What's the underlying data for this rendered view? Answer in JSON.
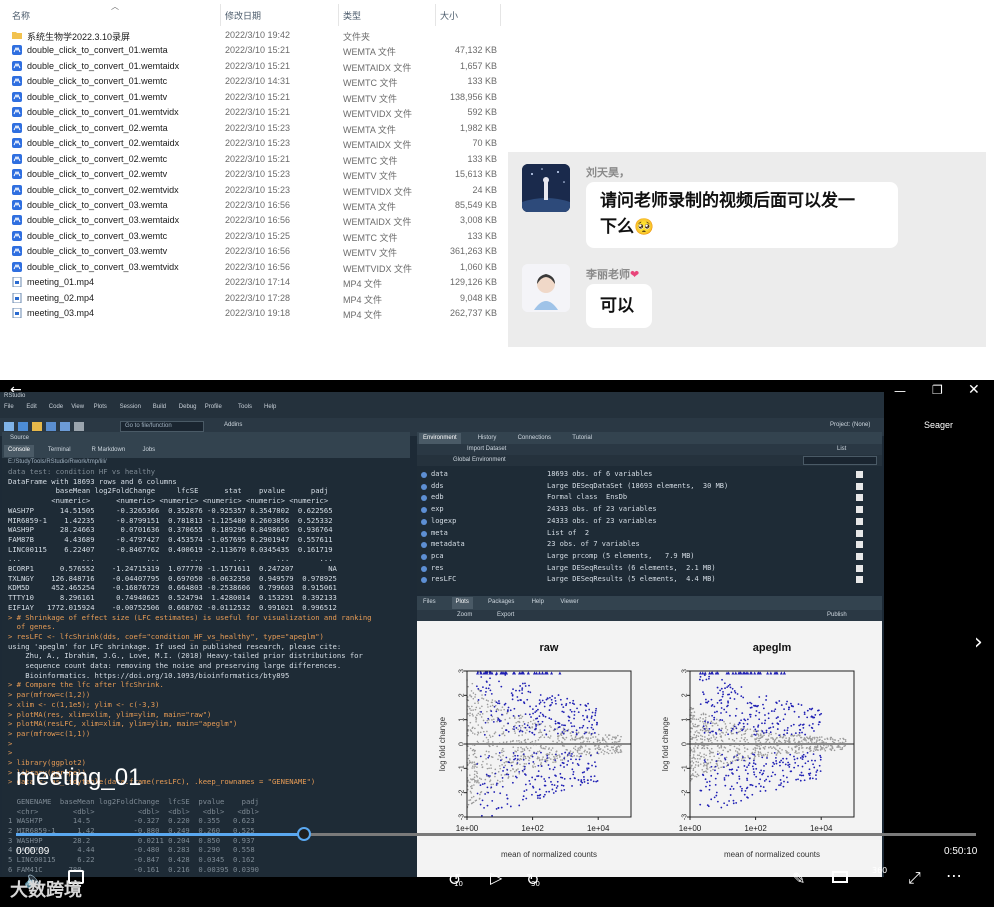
{
  "explorer": {
    "columns": {
      "name": "名称",
      "date": "修改日期",
      "type": "类型",
      "size": "大小"
    },
    "files": [
      {
        "name": "系统生物学2022.3.10录屏",
        "date": "2022/3/10 19:42",
        "type": "文件夹",
        "size": "",
        "icon": "folder-icon"
      },
      {
        "name": "double_click_to_convert_01.wemta",
        "date": "2022/3/10 15:21",
        "type": "WEMTA 文件",
        "size": "47,132 KB",
        "icon": "wemeet-file-icon"
      },
      {
        "name": "double_click_to_convert_01.wemtaidx",
        "date": "2022/3/10 15:21",
        "type": "WEMTAIDX 文件",
        "size": "1,657 KB",
        "icon": "wemeet-file-icon"
      },
      {
        "name": "double_click_to_convert_01.wemtc",
        "date": "2022/3/10 14:31",
        "type": "WEMTC 文件",
        "size": "133 KB",
        "icon": "wemeet-file-icon"
      },
      {
        "name": "double_click_to_convert_01.wemtv",
        "date": "2022/3/10 15:21",
        "type": "WEMTV 文件",
        "size": "138,956 KB",
        "icon": "wemeet-file-icon"
      },
      {
        "name": "double_click_to_convert_01.wemtvidx",
        "date": "2022/3/10 15:21",
        "type": "WEMTVIDX 文件",
        "size": "592 KB",
        "icon": "wemeet-file-icon"
      },
      {
        "name": "double_click_to_convert_02.wemta",
        "date": "2022/3/10 15:23",
        "type": "WEMTA 文件",
        "size": "1,982 KB",
        "icon": "wemeet-file-icon"
      },
      {
        "name": "double_click_to_convert_02.wemtaidx",
        "date": "2022/3/10 15:23",
        "type": "WEMTAIDX 文件",
        "size": "70 KB",
        "icon": "wemeet-file-icon"
      },
      {
        "name": "double_click_to_convert_02.wemtc",
        "date": "2022/3/10 15:21",
        "type": "WEMTC 文件",
        "size": "133 KB",
        "icon": "wemeet-file-icon"
      },
      {
        "name": "double_click_to_convert_02.wemtv",
        "date": "2022/3/10 15:23",
        "type": "WEMTV 文件",
        "size": "15,613 KB",
        "icon": "wemeet-file-icon"
      },
      {
        "name": "double_click_to_convert_02.wemtvidx",
        "date": "2022/3/10 15:23",
        "type": "WEMTVIDX 文件",
        "size": "24 KB",
        "icon": "wemeet-file-icon"
      },
      {
        "name": "double_click_to_convert_03.wemta",
        "date": "2022/3/10 16:56",
        "type": "WEMTA 文件",
        "size": "85,549 KB",
        "icon": "wemeet-file-icon"
      },
      {
        "name": "double_click_to_convert_03.wemtaidx",
        "date": "2022/3/10 16:56",
        "type": "WEMTAIDX 文件",
        "size": "3,008 KB",
        "icon": "wemeet-file-icon"
      },
      {
        "name": "double_click_to_convert_03.wemtc",
        "date": "2022/3/10 15:25",
        "type": "WEMTC 文件",
        "size": "133 KB",
        "icon": "wemeet-file-icon"
      },
      {
        "name": "double_click_to_convert_03.wemtv",
        "date": "2022/3/10 16:56",
        "type": "WEMTV 文件",
        "size": "361,263 KB",
        "icon": "wemeet-file-icon"
      },
      {
        "name": "double_click_to_convert_03.wemtvidx",
        "date": "2022/3/10 16:56",
        "type": "WEMTVIDX 文件",
        "size": "1,060 KB",
        "icon": "wemeet-file-icon"
      },
      {
        "name": "meeting_01.mp4",
        "date": "2022/3/10 17:14",
        "type": "MP4 文件",
        "size": "129,126 KB",
        "icon": "mp4-file-icon"
      },
      {
        "name": "meeting_02.mp4",
        "date": "2022/3/10 17:28",
        "type": "MP4 文件",
        "size": "9,048 KB",
        "icon": "mp4-file-icon"
      },
      {
        "name": "meeting_03.mp4",
        "date": "2022/3/10 19:18",
        "type": "MP4 文件",
        "size": "262,737 KB",
        "icon": "mp4-file-icon"
      }
    ]
  },
  "chat": {
    "msg1": {
      "sender": "刘天昊，",
      "text_line1": "请问老师录制的视频后面可以发一",
      "text_line2": "下么",
      "emoji": "🥺"
    },
    "msg2": {
      "sender": "李丽老师",
      "heart": "❤",
      "text": "可以"
    }
  },
  "player": {
    "caption": "meeting_01",
    "viewer_name": "Seager",
    "time_current": "0:00:09",
    "time_total": "0:50:10",
    "progress": 0.3,
    "skip_back": "10",
    "skip_forward": "30",
    "quality": "360",
    "watermark": "大数跨境",
    "accent": "#5aa8f0"
  },
  "rstudio": {
    "title": "RStudio",
    "menu": [
      "File",
      "Edit",
      "Code",
      "View",
      "Plots",
      "Session",
      "Build",
      "Debug",
      "Profile",
      "Tools",
      "Help"
    ],
    "go_to": "Go to file/function",
    "addins": "Addins",
    "project": "Project: (None)",
    "source_tab": "Source",
    "console_tabs": [
      "Console",
      "Terminal",
      "R Markdown",
      "Jobs"
    ],
    "console_path": "E:/StudyTools/RStudio/Rwork/tmp/lili/",
    "console_lines": [
      {
        "t": "data test: condition HF vs healthy",
        "c": "fade"
      },
      {
        "t": "DataFrame with 18693 rows and 6 columns",
        "c": ""
      },
      {
        "t": "           baseMean log2FoldChange     lfcSE      stat    pvalue      padj",
        "c": ""
      },
      {
        "t": "          <numeric>      <numeric> <numeric> <numeric> <numeric> <numeric>",
        "c": ""
      },
      {
        "t": "WASH7P      14.51505     -0.3265366  0.352876 -0.925357 0.3547802  0.622565",
        "c": ""
      },
      {
        "t": "MIR6859-1    1.42235     -0.8799151  0.781813 -1.125480 0.2603856  0.525332",
        "c": ""
      },
      {
        "t": "WASH9P      28.24663      0.0701636  0.370655  0.189296 0.8498605  0.936764",
        "c": ""
      },
      {
        "t": "FAM87B       4.43689     -0.4797427  0.453574 -1.057695 0.2901947  0.557611",
        "c": ""
      },
      {
        "t": "LINC00115    6.22407     -0.8467762  0.400619 -2.113670 0.0345435  0.161719",
        "c": ""
      },
      {
        "t": "...              ...            ...       ...       ...       ...       ...",
        "c": ""
      },
      {
        "t": "BCORP1      0.576552    -1.24715319  1.077770 -1.1571611  0.247207        NA",
        "c": ""
      },
      {
        "t": "TXLNGY    126.848716    -0.04407795  0.697050 -0.0632350  0.949579  0.978925",
        "c": ""
      },
      {
        "t": "KDM5D     452.465254    -0.16876729  0.664803 -0.2538606  0.799603  0.915061",
        "c": ""
      },
      {
        "t": "TTTY10      8.296161     0.74940625  0.524794  1.4280014  0.153291  0.392133",
        "c": ""
      },
      {
        "t": "EIF1AY   1772.015924    -0.00752506  0.668702 -0.0112532  0.991021  0.996512",
        "c": ""
      },
      {
        "t": "> # Shrinkage of effect size (LFC estimates) is useful for visualization and ranking",
        "c": "cmd"
      },
      {
        "t": "  of genes.",
        "c": "cmd"
      },
      {
        "t": "> resLFC <- lfcShrink(dds, coef=\"condition_HF_vs_healthy\", type=\"apeglm\")",
        "c": "cmd"
      },
      {
        "t": "using 'apeglm' for LFC shrinkage. If used in published research, please cite:",
        "c": ""
      },
      {
        "t": "    Zhu, A., Ibrahim, J.G., Love, M.I. (2018) Heavy-tailed prior distributions for",
        "c": ""
      },
      {
        "t": "    sequence count data: removing the noise and preserving large differences.",
        "c": ""
      },
      {
        "t": "    Bioinformatics. https://doi.org/10.1093/bioinformatics/bty895",
        "c": ""
      },
      {
        "t": "> # Compare the lfc after lfcShrink.",
        "c": "cmd"
      },
      {
        "t": "> par(mfrow=c(1,2))",
        "c": "cmd"
      },
      {
        "t": "> xlim <- c(1,1e5); ylim <- c(-3,3)",
        "c": "cmd"
      },
      {
        "t": "> plotMA(res, xlim=xlim, ylim=ylim, main=\"raw\")",
        "c": "cmd"
      },
      {
        "t": "> plotMA(resLFC, xlim=xlim, ylim=ylim, main=\"apeglm\")",
        "c": "cmd"
      },
      {
        "t": "> par(mfrow=c(1,1))",
        "c": "cmd"
      },
      {
        "t": ">",
        "c": "cmd"
      },
      {
        "t": ">",
        "c": "cmd"
      },
      {
        "t": "> library(ggplot2)",
        "c": "cmd"
      },
      {
        "t": "> library(ggrepel)",
        "c": "cmd"
      },
      {
        "t": "> data <- as_tidytable(data.frame(resLFC), .keep_rownames = \"GENENAME\")",
        "c": "cmd"
      },
      {
        "t": "",
        "c": ""
      },
      {
        "t": "  GENENAME  baseMean log2FoldChange  lfcSE  pvalue    padj",
        "c": "fade"
      },
      {
        "t": "  <chr>        <dbl>          <dbl>  <dbl>   <dbl>   <dbl>",
        "c": "fade"
      },
      {
        "t": "1 WASH7P       14.5          -0.327  0.220  0.355   0.623",
        "c": "fade"
      },
      {
        "t": "2 MIR6859-1     1.42         -0.880  0.249  0.260   0.525",
        "c": "fade"
      },
      {
        "t": "3 WASH9P       28.2           0.0211 0.204  0.850   0.937",
        "c": "fade"
      },
      {
        "t": "4 FAM87B        4.44         -0.480  0.283  0.290   0.558",
        "c": "fade"
      },
      {
        "t": "5 LINC00115     6.22         -0.847  0.428  0.0345  0.162",
        "c": "fade"
      },
      {
        "t": "6 FAM41C      780.           -0.161  0.216  0.00395 0.0390",
        "c": "fade"
      }
    ],
    "env_tabs": [
      "Environment",
      "History",
      "Connections",
      "Tutorial"
    ],
    "import_dataset": "Import Dataset",
    "list_label": "List",
    "global_env": "Global Environment",
    "env_rows": [
      {
        "name": "data",
        "value": "18693 obs. of 6 variables"
      },
      {
        "name": "dds",
        "value": "Large DESeqDataSet (18693 elements,  30 MB)"
      },
      {
        "name": "edb",
        "value": "Formal class  EnsDb"
      },
      {
        "name": "exp",
        "value": "24333 obs. of 23 variables"
      },
      {
        "name": "logexp",
        "value": "24333 obs. of 23 variables"
      },
      {
        "name": "meta",
        "value": "List of  2"
      },
      {
        "name": "metadata",
        "value": "23 obs. of 7 variables"
      },
      {
        "name": "pca",
        "value": "Large prcomp (5 elements,   7.9 MB)"
      },
      {
        "name": "res",
        "value": "Large DESeqResults (6 elements,  2.1 MB)"
      },
      {
        "name": "resLFC",
        "value": "Large DESeqResults (5 elements,  4.4 MB)"
      }
    ],
    "plot_tabs": [
      "Files",
      "Plots",
      "Packages",
      "Help",
      "Viewer"
    ],
    "zoom": "Zoom",
    "export": "Export",
    "publish": "Publish"
  },
  "chart_data": [
    {
      "type": "scatter",
      "title": "raw",
      "xlabel": "mean of normalized counts",
      "ylabel": "log fold change",
      "x_scale": "log",
      "xlim": [
        1,
        100000
      ],
      "ylim": [
        -3,
        3
      ],
      "x_ticks": [
        "1e+00",
        "1e+02",
        "1e+04"
      ],
      "y_ticks": [
        "-3",
        "-2",
        "-1",
        "0",
        "1",
        "2",
        "3"
      ],
      "series": [
        {
          "color": "#9a9a9a"
        },
        {
          "color": "#1f1fb4"
        }
      ],
      "grid": false
    },
    {
      "type": "scatter",
      "title": "apeglm",
      "xlabel": "mean of normalized counts",
      "ylabel": "log fold change",
      "x_scale": "log",
      "xlim": [
        1,
        100000
      ],
      "ylim": [
        -3,
        3
      ],
      "x_ticks": [
        "1e+00",
        "1e+02",
        "1e+04"
      ],
      "y_ticks": [
        "-3",
        "-2",
        "-1",
        "0",
        "1",
        "2",
        "3"
      ],
      "series": [
        {
          "color": "#9a9a9a"
        },
        {
          "color": "#1f1fb4"
        }
      ],
      "grid": false
    }
  ]
}
